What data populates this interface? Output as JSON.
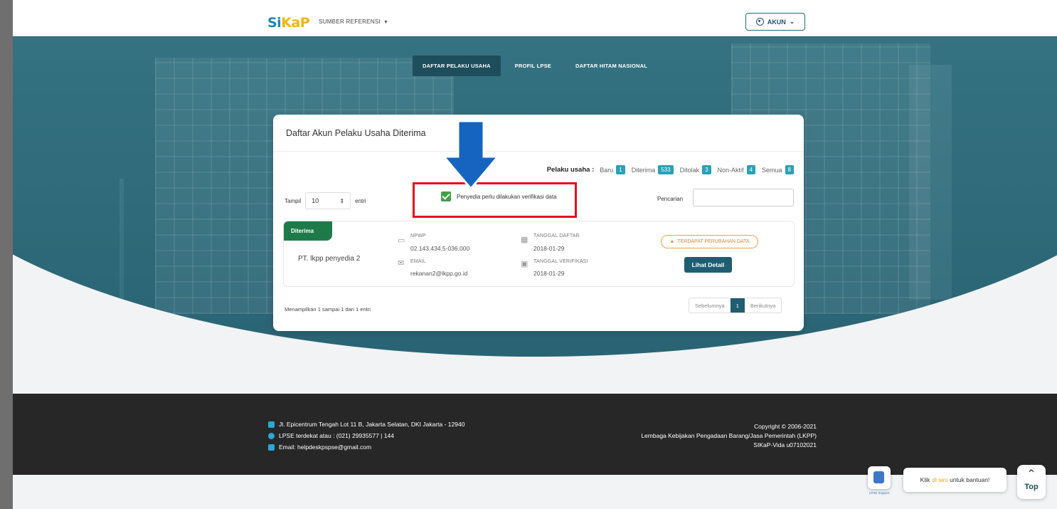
{
  "header": {
    "logo": {
      "part1": "Si",
      "part2": "KaP"
    },
    "menu_label": "SUMBER REFERENSI",
    "account_label": "AKUN"
  },
  "tabs": [
    {
      "label": "DAFTAR PELAKU USAHA",
      "active": true
    },
    {
      "label": "PROFIL LPSE",
      "active": false
    },
    {
      "label": "DAFTAR HITAM NASIONAL",
      "active": false
    }
  ],
  "card": {
    "title": "Daftar Akun Pelaku Usaha Diterima",
    "counts_label": "Pelaku usaha :",
    "counts": [
      {
        "label": "Baru",
        "value": "1"
      },
      {
        "label": "Diterima",
        "value": "533"
      },
      {
        "label": "Ditolak",
        "value": "3"
      },
      {
        "label": "Non-Aktif",
        "value": "4"
      },
      {
        "label": "Semua",
        "value": "8"
      }
    ],
    "show_label": "Tampil",
    "show_value": "10",
    "entries_label": "entri",
    "verify_label": "Penyedia perlu dilakukan verifikasi data",
    "search_label": "Pencarian",
    "search_value": ""
  },
  "record": {
    "status": "Diterima",
    "company": "PT. lkpp penyedia 2",
    "npwp_label": "NPWP",
    "npwp": "02.143.434.5-036.000",
    "email_label": "EMAIL",
    "email": "rekanan2@lkpp.go.id",
    "reg_date_label": "TANGGAL DAFTAR",
    "reg_date": "2018-01-29",
    "ver_date_label": "TANGGAL VERIFIKASI",
    "ver_date": "2018-01-29",
    "warning": "TERDAPAT PERUBAHAN DATA",
    "detail_button": "Lihat Detail"
  },
  "pagination": {
    "showing": "Menampilkan 1 sampai 1 dari 1 entri",
    "prev": "Sebelumnya",
    "current": "1",
    "next": "Berikutnya"
  },
  "footer": {
    "address": "Jl. Epicentrum Tengah Lot 11 B, Jakarta Selatan, DKI Jakarta - 12940",
    "phone": "LPSE terdekat atau : (021) 29935577 | 144",
    "email": "Email: helpdeskpspse@gmail.com",
    "copyright": "Copyright © 2006-2021",
    "org": "Lembaga Kebijakan Pengadaan Barang/Jasa Pemerintah (LKPP)",
    "version": "SIKaP-Vida u07102021"
  },
  "help": {
    "support_caption": "LPSE Support",
    "bubble_pre": "Klik",
    "bubble_link": "di sini",
    "bubble_post": "untuk bantuan!",
    "top_label": "Top"
  },
  "colors": {
    "teal_dark": "#1f5d72",
    "accepted_green": "#1f7a4a",
    "badge": "#2ba0b7",
    "warning": "#e8862c",
    "annotation_red": "#e3121b",
    "annotation_blue": "#1565c0"
  }
}
